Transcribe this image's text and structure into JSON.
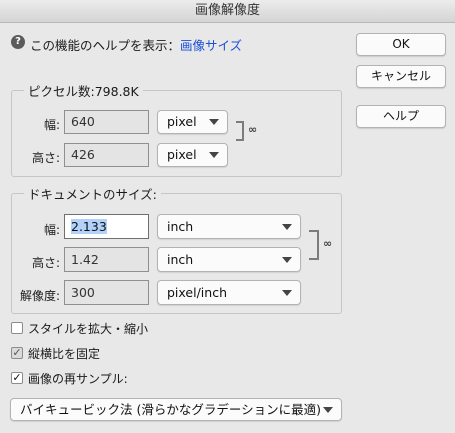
{
  "window": {
    "title": "画像解像度"
  },
  "help": {
    "prefix": "この機能のヘルプを表示：",
    "link": "画像サイズ"
  },
  "buttons": {
    "ok": "OK",
    "cancel": "キャンセル",
    "help": "ヘルプ"
  },
  "pixel_dimensions": {
    "title": "ピクセル数:798.8K",
    "width_label": "幅:",
    "width_value": "640",
    "width_unit": "pixel",
    "height_label": "高さ:",
    "height_value": "426",
    "height_unit": "pixel"
  },
  "document_size": {
    "title": "ドキュメントのサイズ:",
    "width_label": "幅:",
    "width_value": "2.133",
    "width_unit": "inch",
    "height_label": "高さ:",
    "height_value": "1.42",
    "height_unit": "inch",
    "resolution_label": "解像度:",
    "resolution_value": "300",
    "resolution_unit": "pixel/inch"
  },
  "options": {
    "scale_styles": {
      "label": "スタイルを拡大・縮小",
      "checked": false
    },
    "constrain_proportions": {
      "label": "縦横比を固定",
      "checked": true
    },
    "resample": {
      "label": "画像の再サンプル:",
      "checked": true
    }
  },
  "resample_method": "バイキュービック法 (滑らかなグラデーションに最適)",
  "colors": {
    "link": "#1a4fd6",
    "selection": "#b3d2fb"
  }
}
